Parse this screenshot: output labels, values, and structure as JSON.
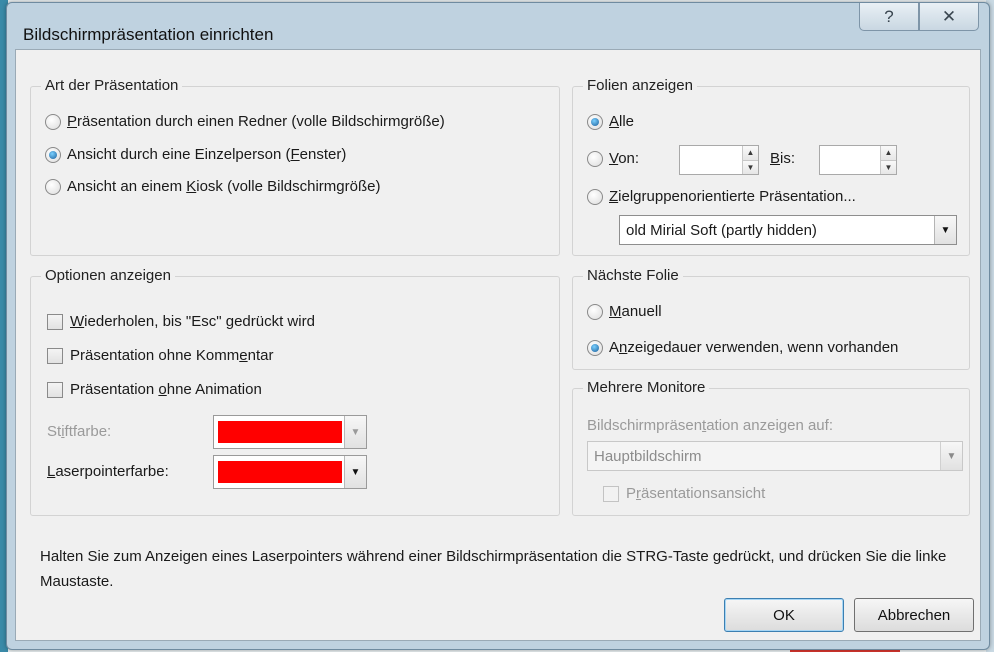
{
  "dialog": {
    "title": "Bildschirmpräsentation einrichten",
    "help_icon": "question-mark-icon",
    "close_icon": "close-x-icon"
  },
  "art": {
    "label": "Art der Präsentation",
    "options": [
      {
        "pre": "",
        "key": "P",
        "post": "räsentation durch einen Redner (volle Bildschirmgröße)",
        "selected": false
      },
      {
        "pre": "Ansicht durch eine Einzelperson (",
        "key": "F",
        "post": "enster)",
        "selected": true
      },
      {
        "pre": "Ansicht an einem ",
        "key": "K",
        "post": "iosk (volle Bildschirmgröße)",
        "selected": false
      }
    ]
  },
  "folien": {
    "label": "Folien anzeigen",
    "alle": {
      "key": "A",
      "post": "lle",
      "selected": true
    },
    "von": {
      "key": "V",
      "post": "on:",
      "value": ""
    },
    "bis": {
      "key": "B",
      "post": "is:",
      "value": ""
    },
    "ziel": {
      "key": "Z",
      "post": "ielgruppenorientierte Präsentation..."
    },
    "dropdown_value": "old Mirial Soft (partly hidden)"
  },
  "optionen": {
    "label": "Optionen anzeigen",
    "checks": [
      {
        "pre": "",
        "key": "W",
        "post": "iederholen, bis \"Esc\" gedrückt wird",
        "checked": false
      },
      {
        "pre": "Präsentation ohne Komm",
        "key": "e",
        "post": "ntar",
        "checked": false
      },
      {
        "pre": "Präsentation ",
        "key": "o",
        "post": "hne Animation",
        "checked": false
      }
    ],
    "stift": {
      "pre": "St",
      "key": "i",
      "post": "ftfarbe:",
      "color": "#ff0000"
    },
    "laser": {
      "pre": "",
      "key": "L",
      "post": "aserpointerfarbe:",
      "color": "#ff0000"
    }
  },
  "naechste": {
    "label": "Nächste Folie",
    "manuell": {
      "key": "M",
      "post": "anuell",
      "selected": false
    },
    "anzeige": {
      "pre": "A",
      "key": "n",
      "post": "zeigedauer verwenden, wenn vorhanden",
      "selected": true
    }
  },
  "monitore": {
    "label": "Mehrere Monitore",
    "anzeigen_auf": {
      "pre": "Bildschirmpräsen",
      "key": "t",
      "post": "ation anzeigen auf:"
    },
    "dropdown_value": "Hauptbildschirm",
    "praes": {
      "pre": "P",
      "key": "r",
      "post": "äsentationsansicht"
    }
  },
  "hint": "Halten Sie zum Anzeigen eines Laserpointers während einer Bildschirmpräsentation die STRG-Taste gedrückt, und drücken Sie die linke Maustaste.",
  "buttons": {
    "ok": "OK",
    "cancel": "Abbrechen"
  },
  "colors": {
    "accent": "#1b5e9a",
    "swatch": "#ff0000",
    "frame": "#bfd2e0"
  }
}
